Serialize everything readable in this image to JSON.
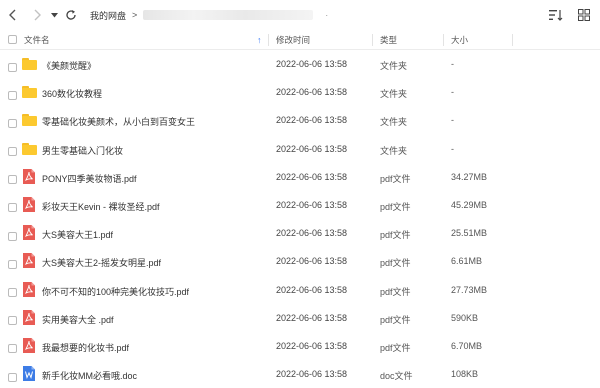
{
  "toolbar": {
    "back_icon": "chevron-left-icon",
    "forward_icon": "chevron-right-icon",
    "history_icon": "caret-down-icon",
    "refresh_icon": "refresh-icon",
    "breadcrumb_root": "我的网盘",
    "breadcrumb_sep": ">",
    "breadcrumb_trailing": "·",
    "sort_icon": "sort-list-icon",
    "grid_icon": "grid-view-icon"
  },
  "columns": {
    "name": "文件名",
    "sort_arrow": "↑",
    "modified": "修改时间",
    "type": "类型",
    "size": "大小"
  },
  "colors": {
    "folder": "#fcc92f",
    "pdf": "#e85b54",
    "doc": "#3d7ce6",
    "sort_accent": "#3b7bf7"
  },
  "files": [
    {
      "name": "《美颜觉醒》",
      "modified": "2022-06-06 13:58",
      "type": "文件夹",
      "size": "-",
      "icon": "folder"
    },
    {
      "name": "360数化妆教程",
      "modified": "2022-06-06 13:58",
      "type": "文件夹",
      "size": "-",
      "icon": "folder"
    },
    {
      "name": "零基础化妆美颜术，从小白到百变女王",
      "modified": "2022-06-06 13:58",
      "type": "文件夹",
      "size": "-",
      "icon": "folder"
    },
    {
      "name": "男生零基础入门化妆",
      "modified": "2022-06-06 13:58",
      "type": "文件夹",
      "size": "-",
      "icon": "folder"
    },
    {
      "name": "PONY四季美妆物语.pdf",
      "modified": "2022-06-06 13:58",
      "type": "pdf文件",
      "size": "34.27MB",
      "icon": "pdf"
    },
    {
      "name": "彩妆天王Kevin - 裸妆圣经.pdf",
      "modified": "2022-06-06 13:58",
      "type": "pdf文件",
      "size": "45.29MB",
      "icon": "pdf"
    },
    {
      "name": "大S美容大王1.pdf",
      "modified": "2022-06-06 13:58",
      "type": "pdf文件",
      "size": "25.51MB",
      "icon": "pdf"
    },
    {
      "name": "大S美容大王2-摇发女明星.pdf",
      "modified": "2022-06-06 13:58",
      "type": "pdf文件",
      "size": "6.61MB",
      "icon": "pdf"
    },
    {
      "name": "你不可不知的100种完美化妆技巧.pdf",
      "modified": "2022-06-06 13:58",
      "type": "pdf文件",
      "size": "27.73MB",
      "icon": "pdf"
    },
    {
      "name": "实用美容大全 .pdf",
      "modified": "2022-06-06 13:58",
      "type": "pdf文件",
      "size": "590KB",
      "icon": "pdf"
    },
    {
      "name": "我最想要的化妆书.pdf",
      "modified": "2022-06-06 13:58",
      "type": "pdf文件",
      "size": "6.70MB",
      "icon": "pdf"
    },
    {
      "name": "新手化妆MM必看哦.doc",
      "modified": "2022-06-06 13:58",
      "type": "doc文件",
      "size": "108KB",
      "icon": "doc"
    }
  ]
}
